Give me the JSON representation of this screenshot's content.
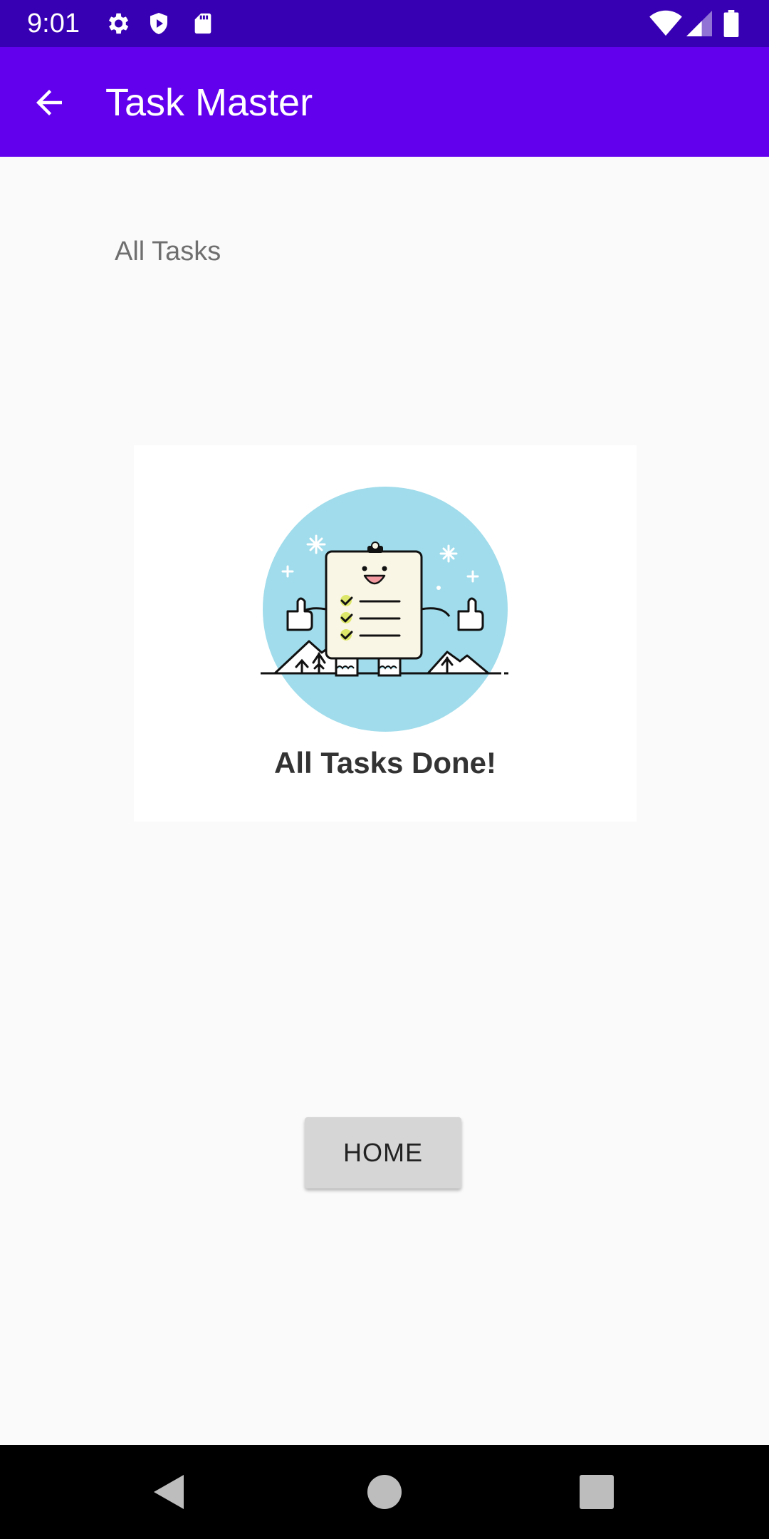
{
  "status_bar": {
    "time": "9:01",
    "left_icons": [
      "gear-icon",
      "shield-play-icon",
      "sd-card-icon"
    ],
    "right_icons": [
      "wifi-icon",
      "signal-icon",
      "battery-icon"
    ]
  },
  "app_bar": {
    "back_icon": "arrow-back-icon",
    "title": "Task Master"
  },
  "main": {
    "section_label": "All Tasks",
    "empty_state": {
      "illustration": "clipboard-mascot-thumbs-up",
      "message": "All Tasks Done!"
    },
    "home_button_label": "HOME"
  },
  "nav_bar": {
    "buttons": [
      "back-triangle-icon",
      "home-circle-icon",
      "recents-square-icon"
    ]
  },
  "colors": {
    "status_bar": "#3700B3",
    "app_bar": "#6200EE",
    "background": "#FAFAFA",
    "illustration_circle": "#A0DCEB"
  }
}
